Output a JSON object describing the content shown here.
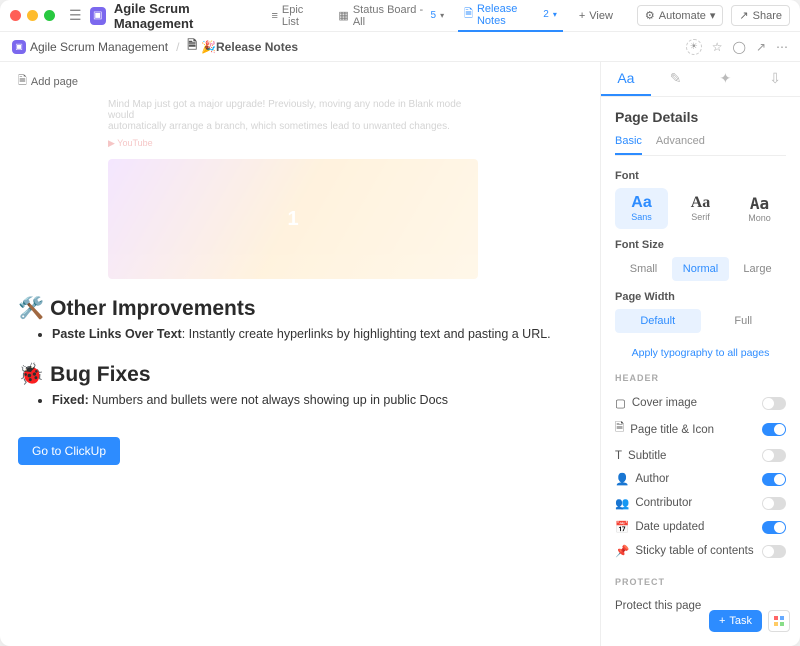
{
  "titlebar": {
    "app_title": "Agile Scrum Management",
    "tabs": [
      {
        "label": "Epic List",
        "badge": ""
      },
      {
        "label": "Status Board - All",
        "badge": "5"
      },
      {
        "label": "Release Notes",
        "badge": "2"
      }
    ],
    "view_btn": "View",
    "automate_btn": "Automate",
    "share_btn": "Share"
  },
  "breadcrumb": {
    "root": "Agile Scrum Management",
    "current": "🎉Release Notes"
  },
  "main": {
    "add_page": "Add page",
    "faded_text_1": "Mind Map just got a major upgrade! Previously, moving any node in Blank mode would",
    "faded_text_2": "automatically arrange a branch, which sometimes lead to unwanted changes.",
    "faded_badge": "YouTube",
    "section_improvements": {
      "emoji": "🛠️",
      "title": "Other Improvements",
      "item_label": "Paste Links Over Text",
      "item_rest": ": Instantly create hyperlinks by highlighting text and pasting a URL."
    },
    "section_bugs": {
      "emoji": "🐞",
      "title": "Bug Fixes",
      "item_label": "Fixed:",
      "item_rest": " Numbers and bullets were not always showing up in public Docs"
    },
    "cta": "Go to ClickUp"
  },
  "sidebar": {
    "title": "Page Details",
    "tab_basic": "Basic",
    "tab_advanced": "Advanced",
    "font_label": "Font",
    "fonts": [
      {
        "big": "Aa",
        "small": "Sans"
      },
      {
        "big": "Aa",
        "small": "Serif"
      },
      {
        "big": "Aa",
        "small": "Mono"
      }
    ],
    "font_size_label": "Font Size",
    "font_sizes": [
      "Small",
      "Normal",
      "Large"
    ],
    "page_width_label": "Page Width",
    "page_widths": [
      "Default",
      "Full"
    ],
    "apply_link": "Apply typography to all pages",
    "header_label": "HEADER",
    "header_items": [
      {
        "label": "Cover image",
        "on": false
      },
      {
        "label": "Page title & Icon",
        "on": true
      },
      {
        "label": "Subtitle",
        "on": false
      },
      {
        "label": "Author",
        "on": true
      },
      {
        "label": "Contributor",
        "on": false
      },
      {
        "label": "Date updated",
        "on": true
      },
      {
        "label": "Sticky table of contents",
        "on": false
      }
    ],
    "protect_label": "PROTECT",
    "protect_item": "Protect this page"
  },
  "floating": {
    "task_btn": "Task"
  }
}
